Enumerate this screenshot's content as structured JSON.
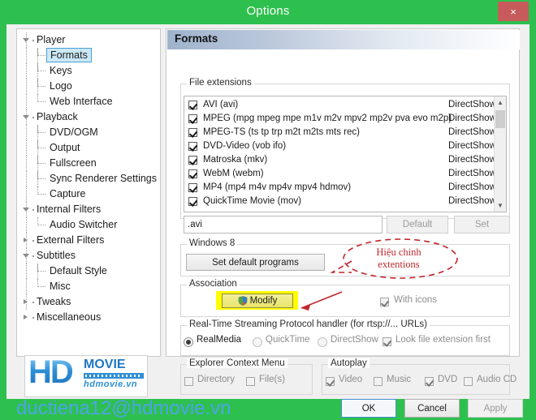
{
  "window": {
    "title": "Options",
    "close_label": "×",
    "frame_color": "#2ec04e",
    "close_color": "#c75b5b"
  },
  "sidebar": {
    "items": [
      {
        "label": "Player",
        "level": 0,
        "expanded": true,
        "selected": false
      },
      {
        "label": "Formats",
        "level": 1,
        "expanded": false,
        "selected": true
      },
      {
        "label": "Keys",
        "level": 1,
        "expanded": false,
        "selected": false
      },
      {
        "label": "Logo",
        "level": 1,
        "expanded": false,
        "selected": false
      },
      {
        "label": "Web Interface",
        "level": 1,
        "expanded": false,
        "selected": false
      },
      {
        "label": "Playback",
        "level": 0,
        "expanded": true,
        "selected": false
      },
      {
        "label": "DVD/OGM",
        "level": 1,
        "expanded": false,
        "selected": false
      },
      {
        "label": "Output",
        "level": 1,
        "expanded": false,
        "selected": false
      },
      {
        "label": "Fullscreen",
        "level": 1,
        "expanded": false,
        "selected": false
      },
      {
        "label": "Sync Renderer Settings",
        "level": 1,
        "expanded": false,
        "selected": false
      },
      {
        "label": "Capture",
        "level": 1,
        "expanded": false,
        "selected": false
      },
      {
        "label": "Internal Filters",
        "level": 0,
        "expanded": true,
        "selected": false
      },
      {
        "label": "Audio Switcher",
        "level": 1,
        "expanded": false,
        "selected": false
      },
      {
        "label": "External Filters",
        "level": 0,
        "expanded": false,
        "selected": false
      },
      {
        "label": "Subtitles",
        "level": 0,
        "expanded": true,
        "selected": false
      },
      {
        "label": "Default Style",
        "level": 1,
        "expanded": false,
        "selected": false
      },
      {
        "label": "Misc",
        "level": 1,
        "expanded": false,
        "selected": false
      },
      {
        "label": "Tweaks",
        "level": 0,
        "expanded": false,
        "selected": false
      },
      {
        "label": "Miscellaneous",
        "level": 0,
        "expanded": false,
        "selected": false
      }
    ]
  },
  "panel": {
    "header": "Formats",
    "file_extensions": {
      "caption": "File extensions",
      "rows": [
        {
          "checked": true,
          "name": "AVI (avi)",
          "handler": "DirectShow"
        },
        {
          "checked": true,
          "name": "MPEG (mpg mpeg mpe m1v m2v mpv2 mp2v pva evo m2p)",
          "handler": "DirectShow"
        },
        {
          "checked": true,
          "name": "MPEG-TS (ts tp trp m2t m2ts mts rec)",
          "handler": "DirectShow"
        },
        {
          "checked": true,
          "name": "DVD-Video (vob ifo)",
          "handler": "DirectShow"
        },
        {
          "checked": true,
          "name": "Matroska (mkv)",
          "handler": "DirectShow"
        },
        {
          "checked": true,
          "name": "WebM (webm)",
          "handler": "DirectShow"
        },
        {
          "checked": true,
          "name": "MP4 (mp4 m4v mp4v mpv4 hdmov)",
          "handler": "DirectShow"
        },
        {
          "checked": true,
          "name": "QuickTime Movie (mov)",
          "handler": "DirectShow"
        }
      ],
      "ext_value": ".avi",
      "ext_placeholder": "",
      "default_button": "Default",
      "set_button": "Set"
    },
    "windows8": {
      "caption": "Windows 8",
      "set_default_programs": "Set default programs"
    },
    "association": {
      "caption": "Association",
      "modify_button": "Modify",
      "with_icons_label": "With icons",
      "with_icons_checked": true,
      "with_icons_enabled": false,
      "highlight_color": "#ffff00"
    },
    "rtsp": {
      "caption": "Real-Time Streaming Protocol handler (for rtsp://... URLs)",
      "options": [
        {
          "label": "RealMedia",
          "selected": true,
          "enabled": true
        },
        {
          "label": "QuickTime",
          "selected": false,
          "enabled": false
        },
        {
          "label": "DirectShow",
          "selected": false,
          "enabled": false
        }
      ],
      "look_file_extension_first": {
        "label": "Look file extension first",
        "checked": true,
        "enabled": false
      }
    },
    "explorer_context_menu": {
      "caption": "Explorer Context Menu",
      "items": [
        {
          "label": "Directory",
          "checked": false,
          "enabled": false
        },
        {
          "label": "File(s)",
          "checked": false,
          "enabled": false
        }
      ]
    },
    "autoplay": {
      "caption": "Autoplay",
      "items": [
        {
          "label": "Video",
          "checked": true,
          "enabled": false
        },
        {
          "label": "Music",
          "checked": false,
          "enabled": false
        },
        {
          "label": "DVD",
          "checked": true,
          "enabled": false
        },
        {
          "label": "Audio CD",
          "checked": false,
          "enabled": false
        }
      ]
    }
  },
  "annotation": {
    "line1": "Hiệu chinh",
    "line2": "extentions",
    "color": "#c1272d"
  },
  "footer": {
    "ok": "OK",
    "cancel": "Cancel",
    "apply": "Apply",
    "apply_enabled": false
  },
  "watermark": {
    "logo_hd": "HD",
    "logo_movie": "MOVIE",
    "logo_domain": "hdmovie.vn",
    "email": "ductiena12@hdmovie.vn",
    "email_color": "#4da3e8"
  }
}
